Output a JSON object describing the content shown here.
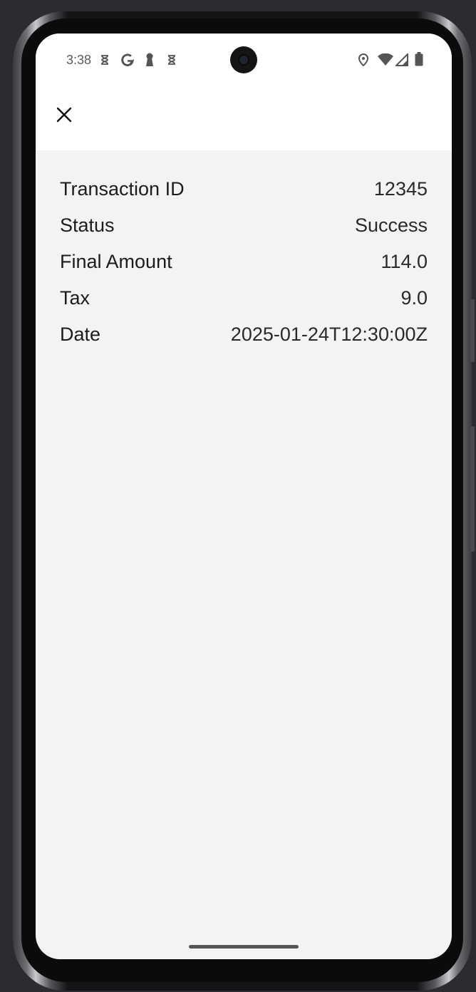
{
  "status_bar": {
    "time": "3:38",
    "left_icons": [
      "hourglass-icon",
      "google-icon",
      "keyhole-icon",
      "hourglass-icon"
    ],
    "right_icons": [
      "location-icon",
      "wifi-icon",
      "signal-icon",
      "battery-icon"
    ]
  },
  "app_bar": {
    "close_icon": "close-icon"
  },
  "transaction": {
    "rows": [
      {
        "label": "Transaction ID",
        "value": "12345"
      },
      {
        "label": "Status",
        "value": "Success"
      },
      {
        "label": "Final Amount",
        "value": "114.0"
      },
      {
        "label": "Tax",
        "value": "9.0"
      },
      {
        "label": "Date",
        "value": "2025-01-24T12:30:00Z"
      }
    ]
  },
  "colors": {
    "screen_background": "#f3f3f3",
    "app_bar_background": "#ffffff",
    "text": "#1c1c1c"
  }
}
